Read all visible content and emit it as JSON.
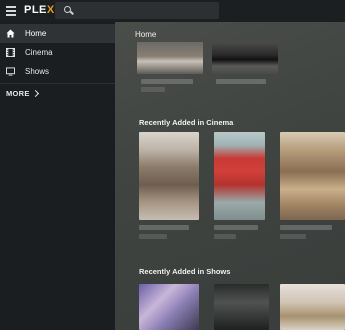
{
  "header": {
    "logo": "PLEX",
    "logo_accent": "X",
    "search": {
      "placeholder": ""
    },
    "icons": [
      "hamburger-icon",
      "search-icon"
    ]
  },
  "sidebar": {
    "items": [
      {
        "label": "Home",
        "icon": "home-icon",
        "active": true
      },
      {
        "label": "Cinema",
        "icon": "film-icon",
        "active": false
      },
      {
        "label": "Shows",
        "icon": "tv-icon",
        "active": false
      }
    ],
    "more_label": "MORE"
  },
  "main": {
    "home_title": "Home",
    "sections": [
      {
        "title": "Recently Added in Cinema"
      },
      {
        "title": "Recently Added in Shows"
      }
    ]
  },
  "colors": {
    "brand_accent": "#e5a00d",
    "sidebar_bg": "#1b1e21",
    "active_item_bg": "#2f3336"
  }
}
